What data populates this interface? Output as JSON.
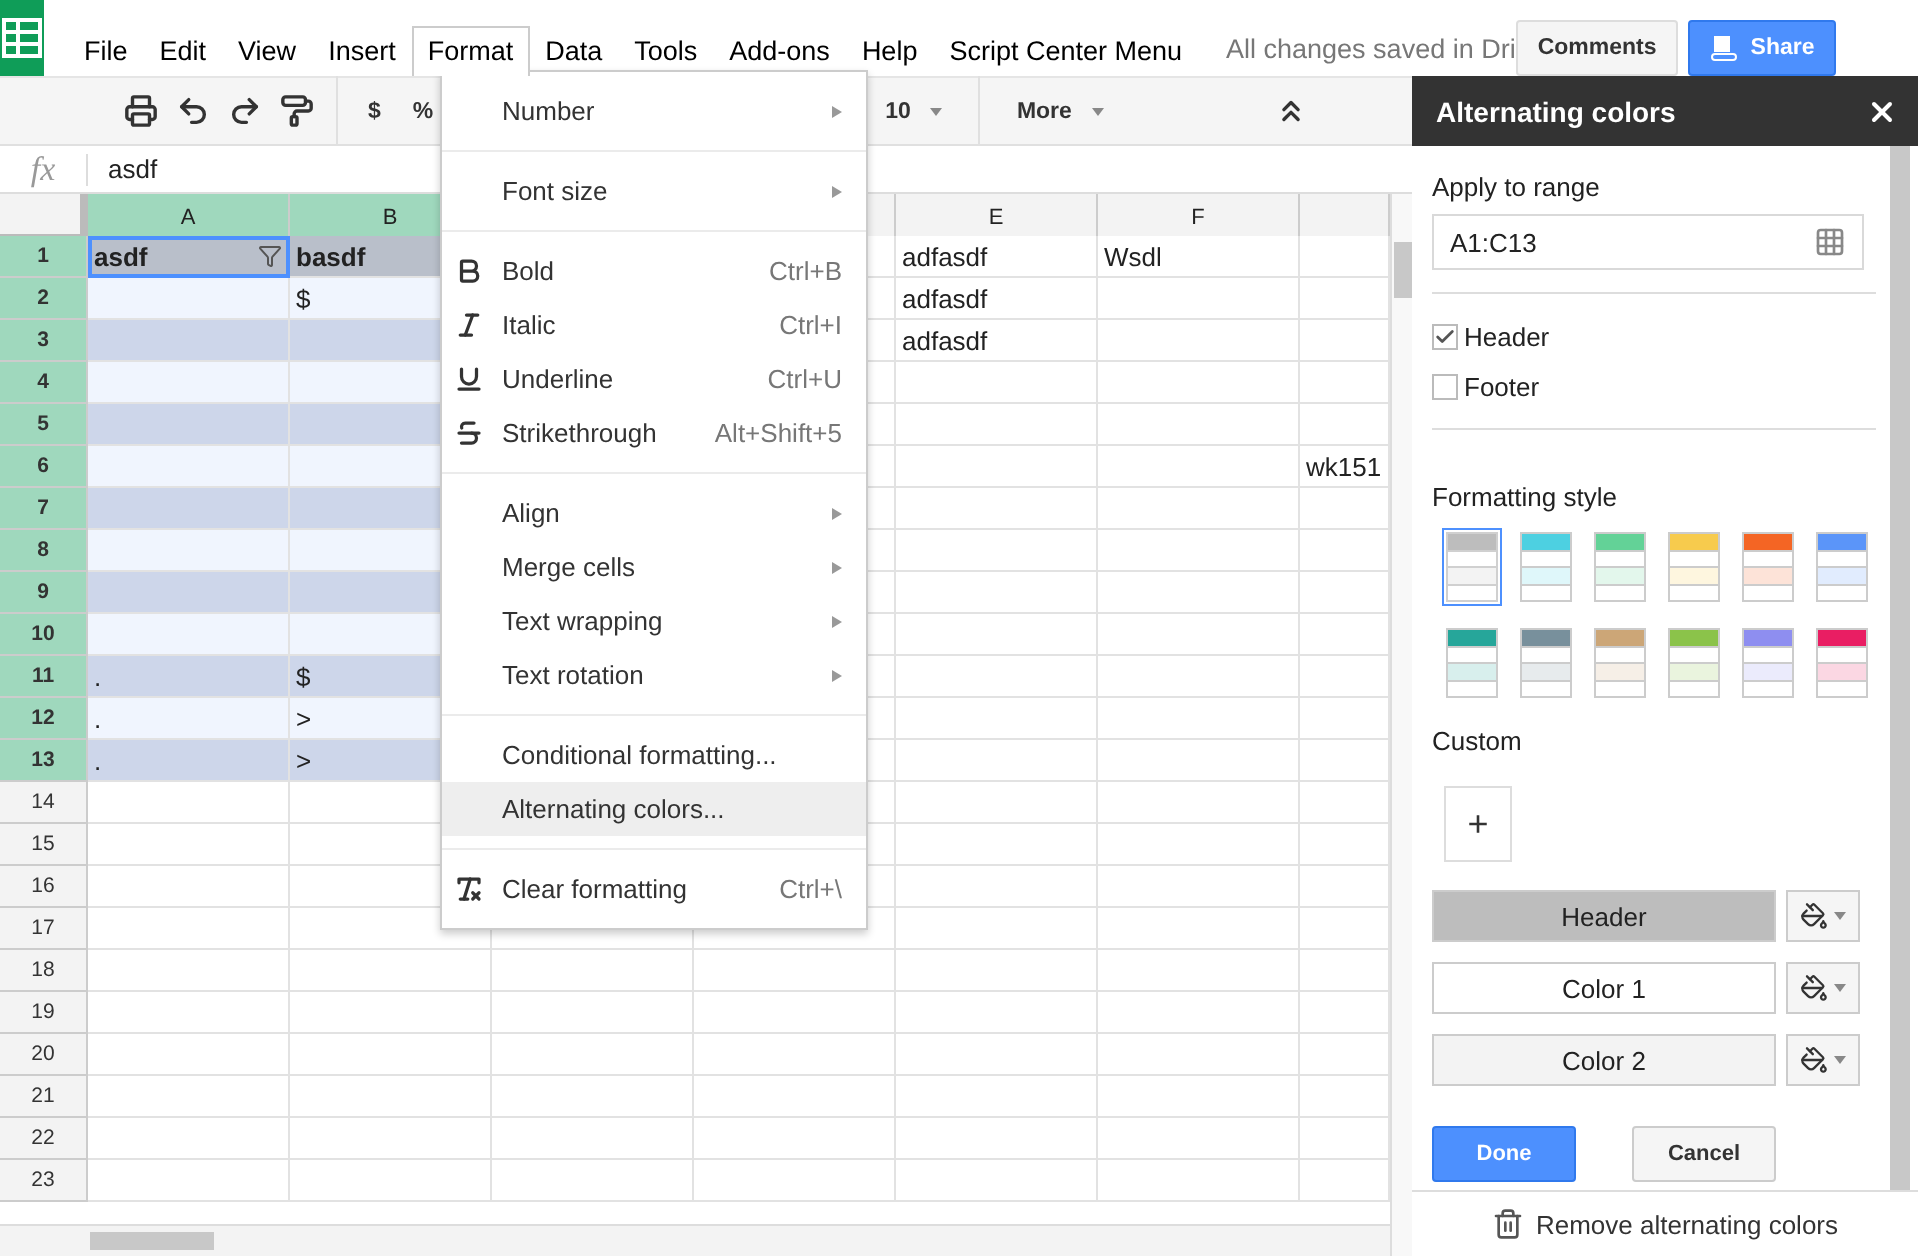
{
  "menubar": [
    {
      "label": "File",
      "selected": false
    },
    {
      "label": "Edit",
      "selected": false
    },
    {
      "label": "View",
      "selected": false
    },
    {
      "label": "Insert",
      "selected": false
    },
    {
      "label": "Format",
      "selected": true
    },
    {
      "label": "Data",
      "selected": false
    },
    {
      "label": "Tools",
      "selected": false
    },
    {
      "label": "Add-ons",
      "selected": false
    },
    {
      "label": "Help",
      "selected": false
    },
    {
      "label": "Script Center Menu",
      "selected": false
    }
  ],
  "save_status": "All changes saved in Dri",
  "header_buttons": [
    {
      "label": "Comments",
      "kind": "plain"
    },
    {
      "label": "Share",
      "kind": "primary"
    }
  ],
  "toolbar": [
    {
      "kind": "print"
    },
    {
      "kind": "undo"
    },
    {
      "kind": "redo"
    },
    {
      "kind": "paint"
    },
    {
      "kind": "sep"
    },
    {
      "kind": "text",
      "label": "$"
    },
    {
      "kind": "text",
      "label": "%"
    },
    {
      "kind": "gap"
    },
    {
      "kind": "dropdown",
      "label": "10"
    },
    {
      "kind": "sep"
    },
    {
      "kind": "dropdown",
      "label": "More"
    },
    {
      "kind": "collapse"
    }
  ],
  "formula_label": "fx",
  "formula": "asdf",
  "columns": [
    {
      "label": "A",
      "selected": true
    },
    {
      "label": "B",
      "selected": true
    },
    {},
    {},
    {
      "label": "E",
      "selected": false
    },
    {
      "label": "F",
      "selected": false
    },
    {}
  ],
  "rows": [
    {
      "number": "1",
      "selected": true,
      "header": true,
      "cells": [
        {
          "text": "asdf",
          "active": true,
          "filter": true
        },
        {
          "text": "basdf"
        },
        {},
        {},
        {
          "text": "adfasdf"
        },
        {
          "text": "Wsdl"
        },
        {}
      ]
    },
    {
      "number": "2",
      "selected": true,
      "alt": false,
      "cells": [
        {},
        {
          "text": "$"
        },
        {},
        {},
        {
          "text": "adfasdf"
        },
        {},
        {}
      ]
    },
    {
      "number": "3",
      "selected": true,
      "alt": true,
      "cells": [
        {},
        {},
        {},
        {},
        {
          "text": "adfasdf"
        },
        {},
        {}
      ]
    },
    {
      "number": "4",
      "selected": true,
      "alt": false,
      "cells": [
        {},
        {},
        {},
        {},
        {},
        {},
        {}
      ]
    },
    {
      "number": "5",
      "selected": true,
      "alt": true,
      "cells": [
        {},
        {},
        {},
        {},
        {},
        {},
        {}
      ]
    },
    {
      "number": "6",
      "selected": true,
      "alt": false,
      "cells": [
        {},
        {},
        {},
        {},
        {},
        {},
        {
          "text": "wk151"
        }
      ]
    },
    {
      "number": "7",
      "selected": true,
      "alt": true,
      "cells": [
        {},
        {},
        {},
        {},
        {},
        {},
        {}
      ]
    },
    {
      "number": "8",
      "selected": true,
      "alt": false,
      "cells": [
        {},
        {},
        {},
        {},
        {},
        {},
        {}
      ]
    },
    {
      "number": "9",
      "selected": true,
      "alt": true,
      "cells": [
        {},
        {},
        {},
        {},
        {},
        {},
        {}
      ]
    },
    {
      "number": "10",
      "selected": true,
      "alt": false,
      "cells": [
        {},
        {},
        {},
        {},
        {},
        {},
        {}
      ]
    },
    {
      "number": "11",
      "selected": true,
      "alt": true,
      "cells": [
        {
          "text": "."
        },
        {
          "text": "$"
        },
        {},
        {},
        {},
        {},
        {}
      ]
    },
    {
      "number": "12",
      "selected": true,
      "alt": false,
      "cells": [
        {
          "text": "."
        },
        {
          "text": ">"
        },
        {},
        {},
        {},
        {},
        {}
      ]
    },
    {
      "number": "13",
      "selected": true,
      "alt": true,
      "cells": [
        {
          "text": "."
        },
        {
          "text": ">"
        },
        {},
        {},
        {},
        {},
        {}
      ]
    },
    {
      "number": "14",
      "selected": false,
      "cells": [
        {},
        {},
        {},
        {},
        {},
        {},
        {}
      ]
    },
    {
      "number": "15",
      "selected": false,
      "cells": [
        {},
        {},
        {},
        {},
        {},
        {},
        {}
      ]
    },
    {
      "number": "16",
      "selected": false,
      "cells": [
        {},
        {},
        {},
        {},
        {},
        {},
        {}
      ]
    },
    {
      "number": "17",
      "selected": false,
      "cells": [
        {},
        {},
        {},
        {},
        {},
        {},
        {}
      ]
    },
    {
      "number": "18",
      "selected": false,
      "cells": [
        {},
        {},
        {},
        {},
        {},
        {},
        {}
      ]
    },
    {
      "number": "19",
      "selected": false,
      "cells": [
        {},
        {},
        {},
        {},
        {},
        {},
        {}
      ]
    },
    {
      "number": "20",
      "selected": false,
      "cells": [
        {},
        {},
        {},
        {},
        {},
        {},
        {}
      ]
    },
    {
      "number": "21",
      "selected": false,
      "cells": [
        {},
        {},
        {},
        {},
        {},
        {},
        {}
      ]
    },
    {
      "number": "22",
      "selected": false,
      "cells": [
        {},
        {},
        {},
        {},
        {},
        {},
        {}
      ]
    },
    {
      "number": "23",
      "selected": false,
      "cells": [
        {},
        {},
        {},
        {},
        {},
        {},
        {}
      ]
    }
  ],
  "format_menu": [
    [
      {
        "label": "Number",
        "kind": "submenu",
        "selected": false
      }
    ],
    [
      {
        "label": "Font size",
        "kind": "submenu",
        "selected": false
      }
    ],
    [
      {
        "label": "Bold",
        "kind": "command",
        "shortcut": "Ctrl+B",
        "selected": false
      },
      {
        "label": "Italic",
        "kind": "command",
        "shortcut": "Ctrl+I",
        "selected": false
      },
      {
        "label": "Underline",
        "kind": "command",
        "shortcut": "Ctrl+U",
        "selected": false
      },
      {
        "label": "Strikethrough",
        "kind": "command",
        "shortcut": "Alt+Shift+5",
        "selected": false
      }
    ],
    [
      {
        "label": "Align",
        "kind": "submenu",
        "selected": false
      },
      {
        "label": "Merge cells",
        "kind": "submenu",
        "selected": false
      },
      {
        "label": "Text wrapping",
        "kind": "submenu",
        "selected": false
      },
      {
        "label": "Text rotation",
        "kind": "submenu",
        "selected": false
      }
    ],
    [
      {
        "label": "Conditional formatting...",
        "kind": "command",
        "selected": false
      },
      {
        "label": "Alternating colors...",
        "kind": "command",
        "selected": true
      }
    ],
    [
      {
        "label": "Clear formatting",
        "kind": "command",
        "shortcut": "Ctrl+\\",
        "selected": false
      }
    ]
  ],
  "panel": {
    "title": "Alternating colors",
    "range_label": "Apply to range",
    "range_value": "A1:C13",
    "checkboxes": [
      {
        "label": "Header",
        "checked": true
      },
      {
        "label": "Footer",
        "checked": false
      }
    ],
    "style_label": "Formatting style",
    "styles": [
      {
        "color": "#bdbdbd",
        "selected": true
      },
      {
        "color": "#4dd0e1",
        "selected": false
      },
      {
        "color": "#63d297",
        "selected": false
      },
      {
        "color": "#f7cb4d",
        "selected": false
      },
      {
        "color": "#f46524",
        "selected": false
      },
      {
        "color": "#5b95f9",
        "selected": false
      },
      {
        "color": "#26a69a",
        "selected": false
      },
      {
        "color": "#78909c",
        "selected": false
      },
      {
        "color": "#cca677",
        "selected": false
      },
      {
        "color": "#8bc34a",
        "selected": false
      },
      {
        "color": "#8e8ef0",
        "selected": false
      },
      {
        "color": "#e91e63",
        "selected": false
      }
    ],
    "custom_label": "Custom",
    "add_label": "+",
    "color_rows": [
      {
        "label": "Header",
        "color": "#bdbdbd"
      },
      {
        "label": "Color 1",
        "color": "#ffffff"
      },
      {
        "label": "Color 2",
        "color": "#f3f3f3"
      }
    ],
    "buttons": [
      {
        "label": "Done",
        "kind": "primary"
      },
      {
        "label": "Cancel",
        "kind": "plain"
      }
    ],
    "remove_label": "Remove alternating colors"
  }
}
